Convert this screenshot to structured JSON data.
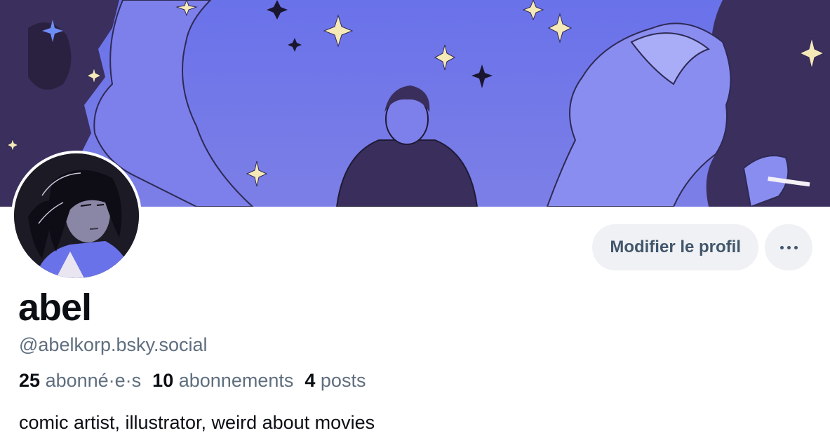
{
  "profile": {
    "display_name": "abel",
    "handle": "@abelkorp.bsky.social",
    "bio": "comic artist, illustrator, weird about movies",
    "stats": [
      {
        "count": "25",
        "label": "abonné·e·s"
      },
      {
        "count": "10",
        "label": "abonnements"
      },
      {
        "count": "4",
        "label": "posts"
      }
    ]
  },
  "actions": {
    "edit_label": "Modifier le profil",
    "more_icon": "ellipsis-icon"
  },
  "colors": {
    "banner_sky": "#6b73e6",
    "banner_dark": "#3a2f5c",
    "star_yellow": "#f6e9b8",
    "button_bg": "#eff1f4",
    "button_text": "#42566c",
    "secondary_text": "#5f6e7e",
    "primary_text": "#0b0f14"
  }
}
